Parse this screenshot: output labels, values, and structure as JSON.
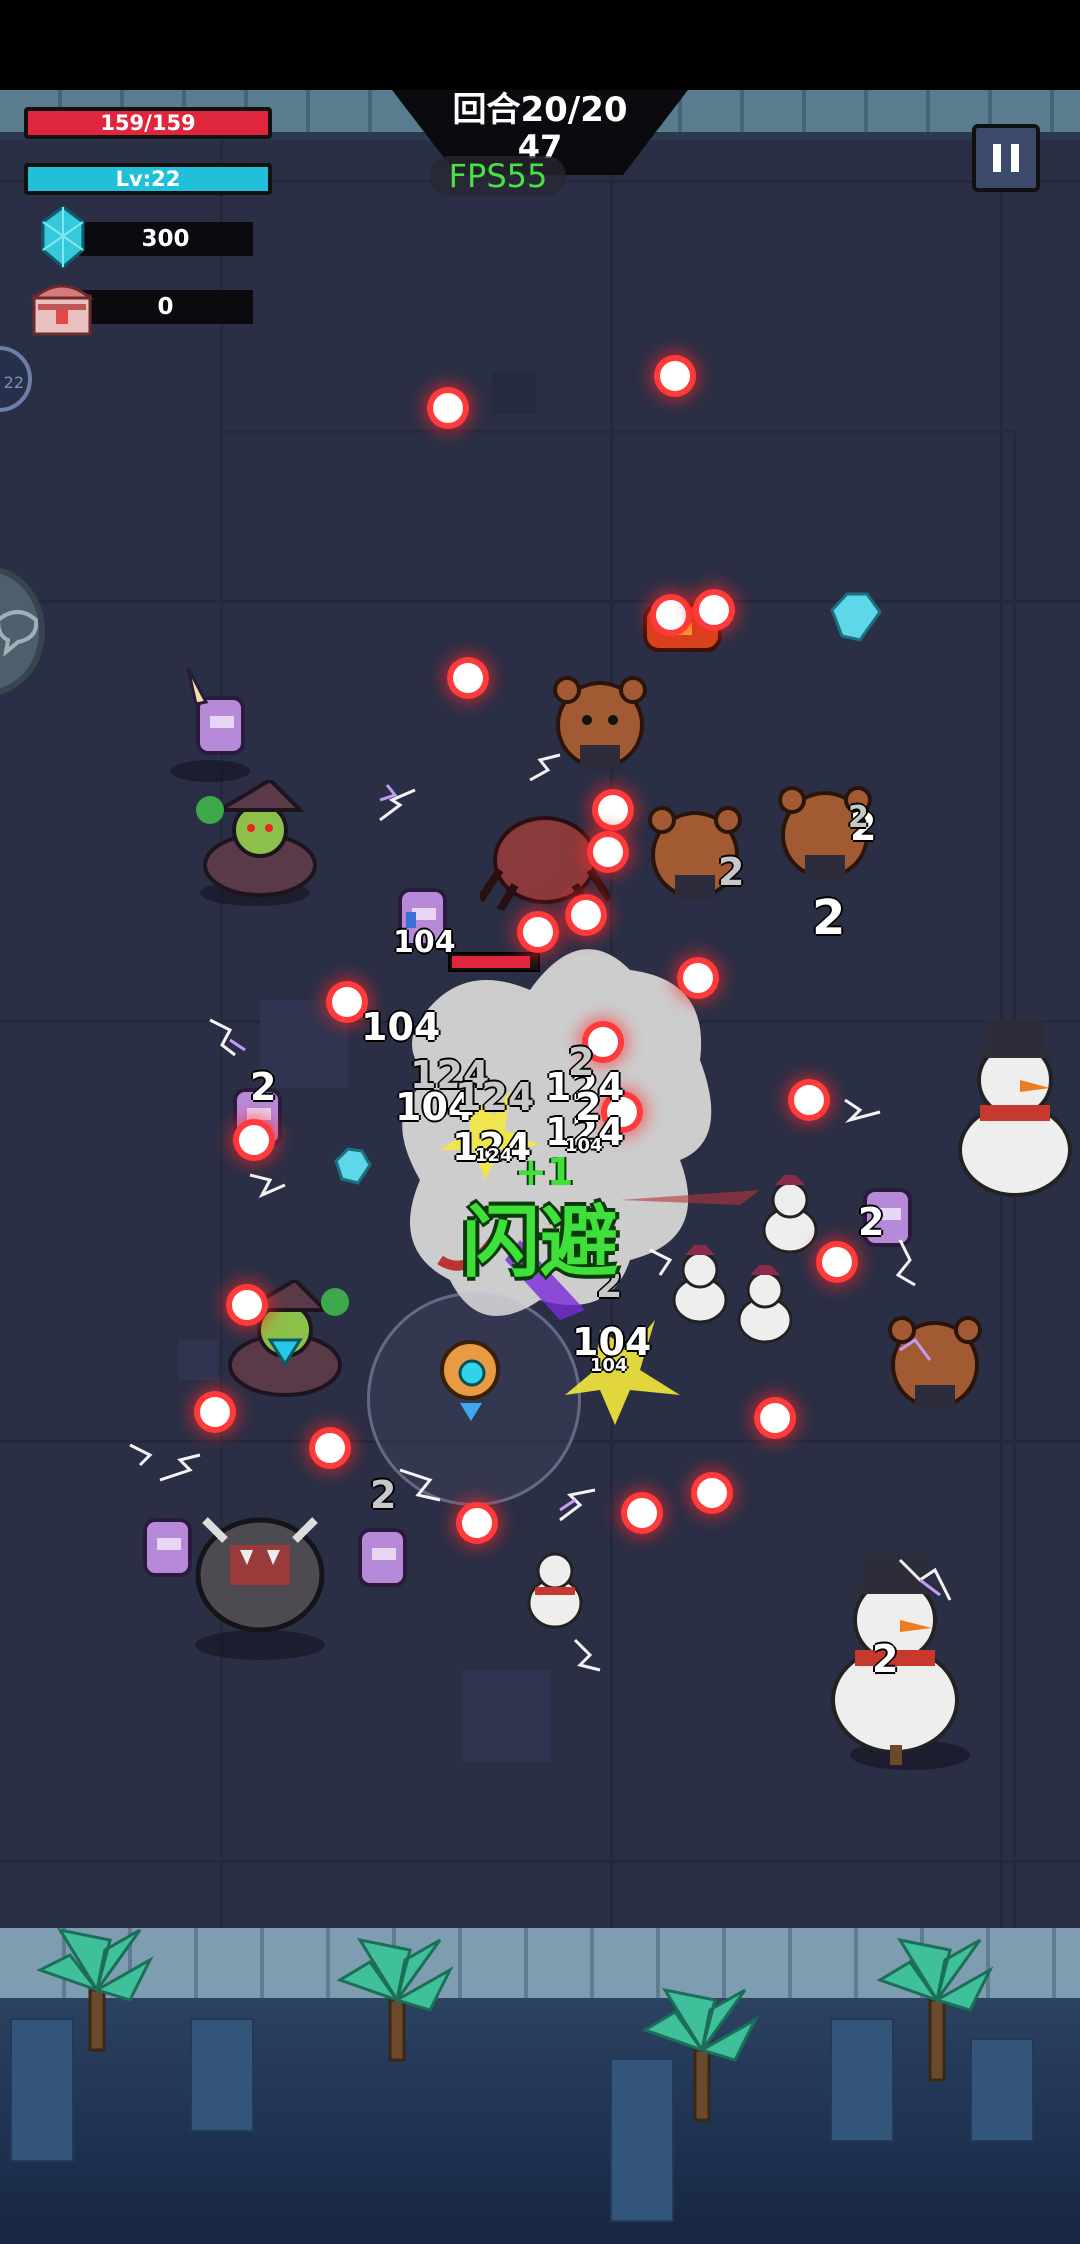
{
  "hud": {
    "hp": "159/159",
    "level": "Lv:22",
    "gems": "300",
    "chests": "0",
    "round": "回合20/20",
    "timer": "47",
    "fps": "FPS55",
    "side_badge": "22"
  },
  "combat_texts": {
    "dodge": "闪避",
    "plus_one": "+1",
    "damage_values": [
      "104",
      "124",
      "2"
    ]
  },
  "icons": {
    "gem": "cyan-crystal-icon",
    "chest": "treasure-chest-icon",
    "pause": "pause-icon",
    "bullet": "red-energy-orb"
  },
  "colors": {
    "hp_bar": "#e0263d",
    "level_bar": "#20c0d8",
    "fps_text": "#48e048",
    "dodge_text": "#3fe03a",
    "floor": "#2a2f46"
  }
}
